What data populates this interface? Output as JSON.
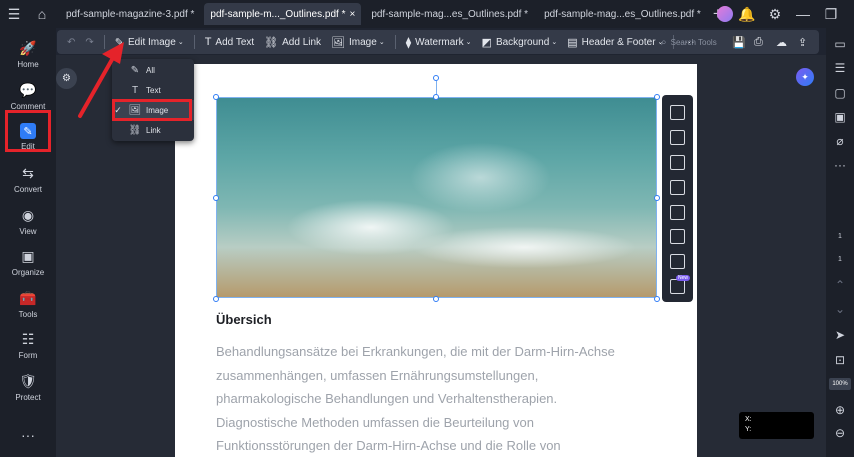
{
  "tabs": [
    {
      "label": "pdf-sample-magazine-3.pdf *",
      "active": false
    },
    {
      "label": "pdf-sample-m..._Outlines.pdf *",
      "active": true
    },
    {
      "label": "pdf-sample-mag...es_Outlines.pdf *",
      "active": false
    },
    {
      "label": "pdf-sample-mag...es_Outlines.pdf *",
      "active": false
    }
  ],
  "tab_close": "×",
  "tab_add": "+",
  "sidebar": [
    {
      "label": "Home",
      "icon": "rocket-icon"
    },
    {
      "label": "Comment",
      "icon": "comment-icon"
    },
    {
      "label": "Edit",
      "icon": "edit-icon"
    },
    {
      "label": "Convert",
      "icon": "convert-icon"
    },
    {
      "label": "View",
      "icon": "eye-icon"
    },
    {
      "label": "Organize",
      "icon": "organize-icon"
    },
    {
      "label": "Tools",
      "icon": "toolbox-icon"
    },
    {
      "label": "Form",
      "icon": "form-icon"
    },
    {
      "label": "Protect",
      "icon": "shield-icon"
    }
  ],
  "toolbar": {
    "edit_image": "Edit Image",
    "add_text": "Add Text",
    "add_link": "Add Link",
    "image": "Image",
    "watermark": "Watermark",
    "background": "Background",
    "header_footer": "Header & Footer",
    "more": "···",
    "search_placeholder": "Search Tools"
  },
  "dropdown": {
    "items": [
      "All",
      "Text",
      "Image",
      "Link"
    ],
    "selected": "Image",
    "check": "✓"
  },
  "document": {
    "heading": "Übersich",
    "lines": [
      "Behandlungsansätze bei Erkrankungen, die mit der Darm-Hirn-Achse",
      "zusammenhängen, umfassen Ernährungsumstellungen,",
      "pharmakologische Behandlungen und Verhaltenstherapien.",
      "Diagnostische Methoden umfassen die Beurteilung von",
      "Funktionsstörungen der Darm-Hirn-Achse und die Rolle von"
    ]
  },
  "image_toolbar": {
    "new_badge": "New"
  },
  "right_rail": {
    "page_current": "1",
    "page_total": "1",
    "zoom": "100%"
  },
  "coords": {
    "x_label": "X:",
    "y_label": "Y:"
  },
  "colors": {
    "accent": "#2f7cf6",
    "highlight": "#e5232a",
    "arrow": "#e5232a"
  }
}
